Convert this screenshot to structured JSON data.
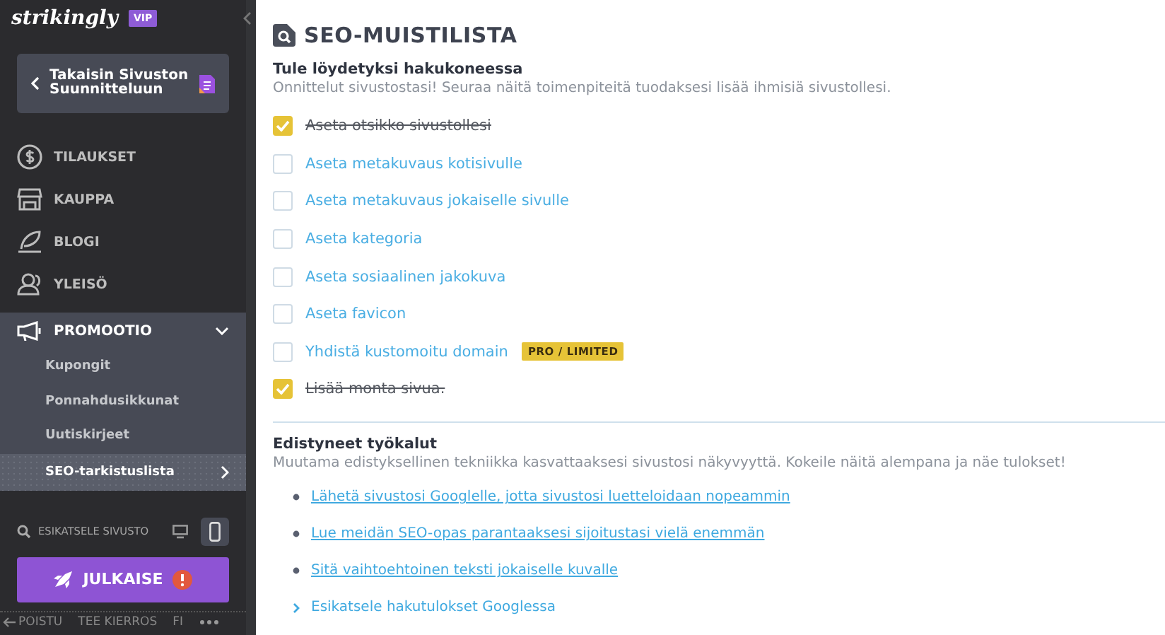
{
  "sidebar": {
    "logo": "strikingly",
    "badge": "VIP",
    "back_button": "Takaisin Sivuston Suunnitteluun",
    "nav": [
      {
        "label": "TILAUKSET"
      },
      {
        "label": "KAUPPA"
      },
      {
        "label": "BLOGI"
      },
      {
        "label": "YLEISÖ"
      }
    ],
    "section": {
      "label": "PROMOOTIO",
      "expanded": true,
      "items": [
        {
          "label": "Kupongit",
          "selected": false
        },
        {
          "label": "Ponnahdusikkunat",
          "selected": false
        },
        {
          "label": "Uutiskirjeet",
          "selected": false
        },
        {
          "label": "SEO-tarkistuslista",
          "selected": true
        }
      ]
    },
    "preview": {
      "label": "ESIKATSELE SIVUSTO",
      "devices": [
        {
          "kind": "desktop",
          "selected": false
        },
        {
          "kind": "mobile",
          "selected": true
        }
      ]
    },
    "publish_button": "JULKAISE",
    "footer": [
      "POISTU",
      "TEE KIERROS",
      "FI"
    ]
  },
  "main": {
    "title": "SEO-MUISTILISTA",
    "checklist": {
      "heading": "Tule löydetyksi hakukoneessa",
      "description": "Onnittelut sivustostasi! Seuraa näitä toimenpiteitä tuodaksesi lisää ihmisiä sivustollesi.",
      "items": [
        {
          "label": "Aseta otsikko sivustollesi",
          "checked": true
        },
        {
          "label": "Aseta metakuvaus kotisivulle",
          "checked": false
        },
        {
          "label": "Aseta metakuvaus jokaiselle sivulle",
          "checked": false
        },
        {
          "label": "Aseta kategoria",
          "checked": false
        },
        {
          "label": "Aseta sosiaalinen jakokuva",
          "checked": false
        },
        {
          "label": "Aseta favicon",
          "checked": false
        },
        {
          "label": "Yhdistä kustomoitu domain",
          "checked": false,
          "badge": "PRO / LIMITED"
        },
        {
          "label": "Lisää monta sivua.",
          "checked": true
        }
      ]
    },
    "tools": {
      "heading": "Edistyneet työkalut",
      "description": "Muutama edistyksellinen tekniikka kasvattaaksesi sivustosi näkyvyyttä. Kokeile näitä alempana ja näe tulokset!",
      "links": [
        {
          "label": "Lähetä sivustosi Googlelle, jotta sivustosi luetteloidaan nopeammin",
          "kind": "bullet"
        },
        {
          "label": "Lue meidän SEO-opas parantaaksesi sijoitustasi vielä enemmän",
          "kind": "bullet"
        },
        {
          "label": "Sitä vaihtoehtoinen teksti jokaiselle kuvalle",
          "kind": "bullet"
        },
        {
          "label": "Esikatsele hakutulokset Googlessa",
          "kind": "expand"
        }
      ]
    }
  }
}
